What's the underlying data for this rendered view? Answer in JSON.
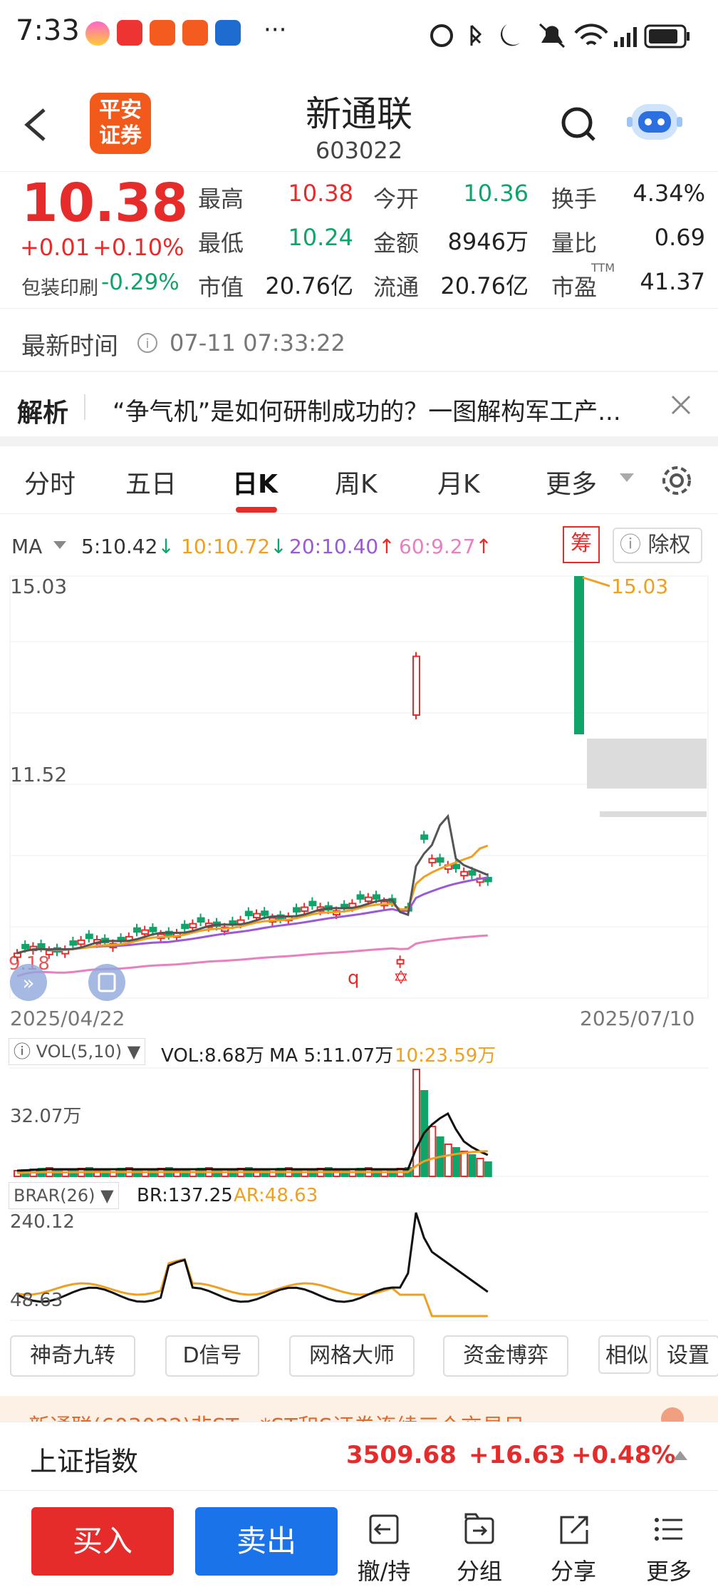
{
  "status": {
    "time": "7:33",
    "dots": "···"
  },
  "header": {
    "name": "新通联",
    "code": "603022",
    "broker_logo": "平安\n证券",
    "back_icon": "chevron-left",
    "search_icon": "search",
    "bot_icon": "robot"
  },
  "quote": {
    "price": "10.38",
    "change": "+0.01",
    "change_pct": "+0.10%",
    "sector_label": "包装印刷",
    "sector_pct": "-0.29%",
    "rows": [
      [
        {
          "label": "最高",
          "value": "10.38",
          "color": "red"
        },
        {
          "label": "今开",
          "value": "10.36",
          "color": "green"
        },
        {
          "label": "换手",
          "value": "4.34%",
          "color": "dark"
        }
      ],
      [
        {
          "label": "最低",
          "value": "10.24",
          "color": "green"
        },
        {
          "label": "金额",
          "value": "8946万",
          "color": "dark"
        },
        {
          "label": "量比",
          "value": "0.69",
          "color": "dark"
        }
      ],
      [
        {
          "label": "市值",
          "value": "20.76亿",
          "color": "dark"
        },
        {
          "label": "流通",
          "value": "20.76亿",
          "color": "dark"
        },
        {
          "label": "市盈",
          "value": "41.37",
          "color": "dark",
          "sup": "TTM"
        }
      ]
    ]
  },
  "latest_time": {
    "label": "最新时间",
    "value": "07-11 07:33:22"
  },
  "news": {
    "label": "解析",
    "text": "“争气机”是如何研制成功的？一图解构军工产..."
  },
  "tabs": {
    "items": [
      "分时",
      "五日",
      "日K",
      "周K",
      "月K",
      "更多"
    ],
    "active": "日K"
  },
  "ma_bar": {
    "ma_label": "MA",
    "ma5": "5:10.42",
    "ma10": "10:10.72",
    "ma20": "20:10.40",
    "ma60": "60:9.27",
    "chip_label": "筹",
    "exright_label": "除权"
  },
  "chart": {
    "y_top": "15.03",
    "y_mid": "11.52",
    "peak_label": "15.03",
    "y_low_partial": "9.18",
    "date_start": "2025/04/22",
    "date_end": "2025/07/10"
  },
  "vol": {
    "label": "VOL(5,10)",
    "vol_text": "VOL:8.68万",
    "ma5_text": "MA 5:11.07万",
    "ma10_text": "10:23.59万",
    "y_label": "32.07万"
  },
  "brar": {
    "label": "BRAR(26)",
    "br_text": "BR:137.25",
    "ar_text": "AR:48.63",
    "y_top": "240.12",
    "y_bottom": "48.63"
  },
  "tools": [
    "神奇九转",
    "D信号",
    "网格大师",
    "资金博弈",
    "相似K线"
  ],
  "tools_settings": "设置",
  "banner": {
    "text": "新通联(603022)非ST、*ST和S证券连续三个交易日"
  },
  "index_bar": {
    "name": "上证指数",
    "value": "3509.68",
    "change": "+16.63",
    "pct": "+0.48%"
  },
  "bottom": {
    "buy": "买入",
    "sell": "卖出",
    "cancel": "撤/持",
    "group": "分组",
    "share": "分享",
    "more": "更多"
  },
  "colors": {
    "up": "#e62b2b",
    "down": "#10a36a",
    "ma5": "#555555",
    "ma10": "#f0a020",
    "ma20": "#9b59d6",
    "ma60": "#e87fbf",
    "buy": "#e62b2b",
    "sell": "#1a73e8"
  }
}
